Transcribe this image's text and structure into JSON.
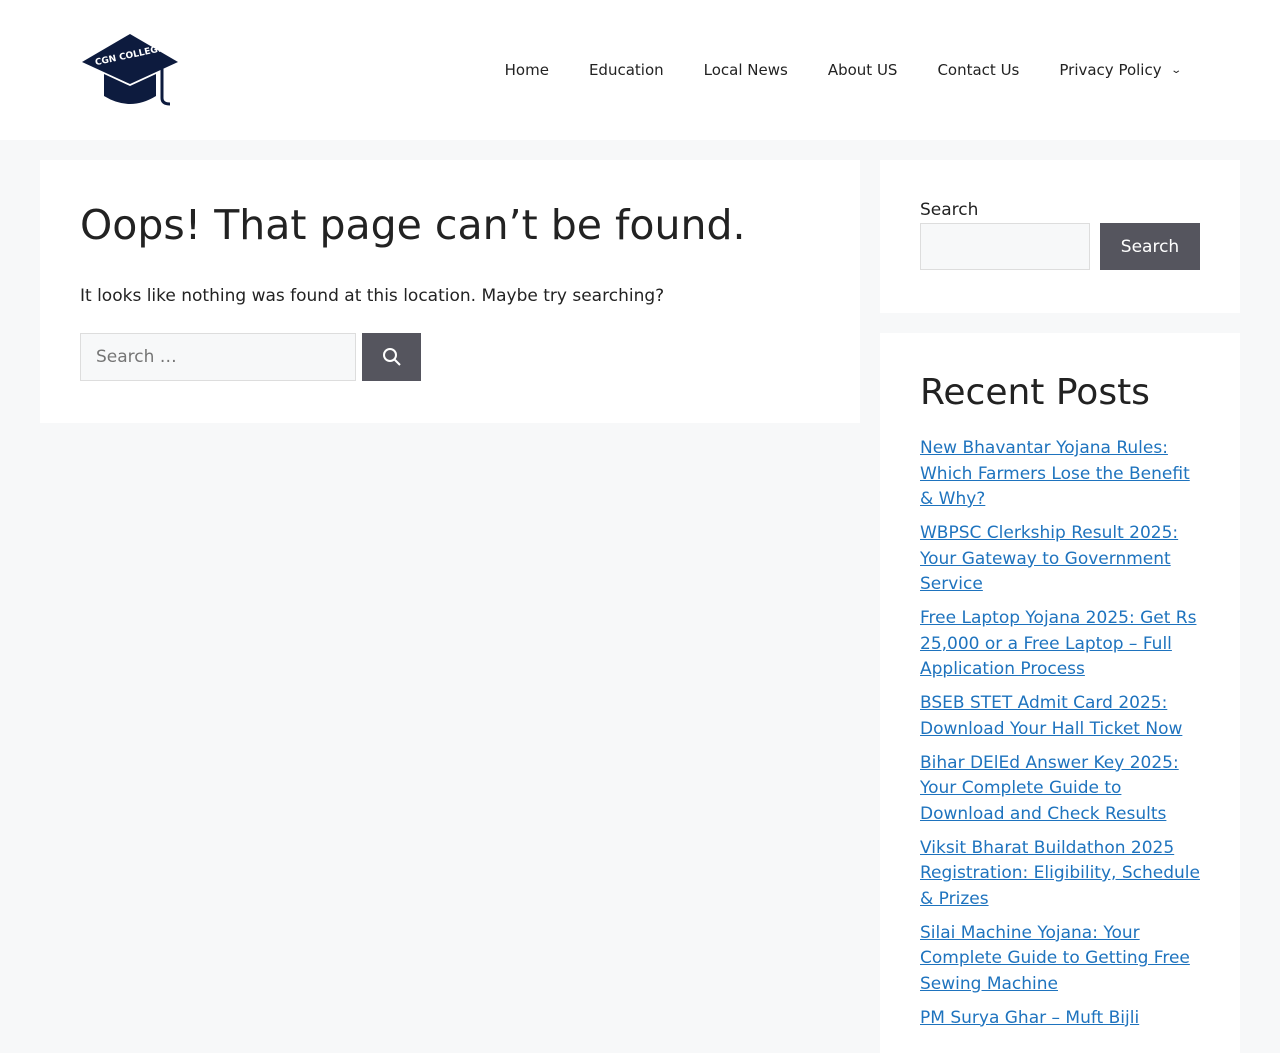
{
  "header": {
    "logo_text": "CGN COLLEGE",
    "nav": [
      "Home",
      "Education",
      "Local News",
      "About US",
      "Contact Us",
      "Privacy Policy"
    ]
  },
  "main": {
    "title": "Oops! That page can’t be found.",
    "message": "It looks like nothing was found at this location. Maybe try searching?",
    "search_placeholder": "Search …"
  },
  "sidebar": {
    "search_label": "Search",
    "search_button": "Search",
    "recent_title": "Recent Posts",
    "posts": [
      "New Bhavantar Yojana Rules: Which Farmers Lose the Benefit & Why?",
      "WBPSC Clerkship Result 2025: Your Gateway to Government Service",
      "Free Laptop Yojana 2025: Get Rs 25,000 or a Free Laptop – Full Application Process",
      "BSEB STET Admit Card 2025: Download Your Hall Ticket Now",
      "Bihar DElEd Answer Key 2025: Your Complete Guide to Download and Check Results",
      "Viksit Bharat Buildathon 2025 Registration: Eligibility, Schedule & Prizes",
      "Silai Machine Yojana: Your Complete Guide to Getting Free Sewing Machine",
      "PM Surya Ghar – Muft Bijli"
    ]
  }
}
